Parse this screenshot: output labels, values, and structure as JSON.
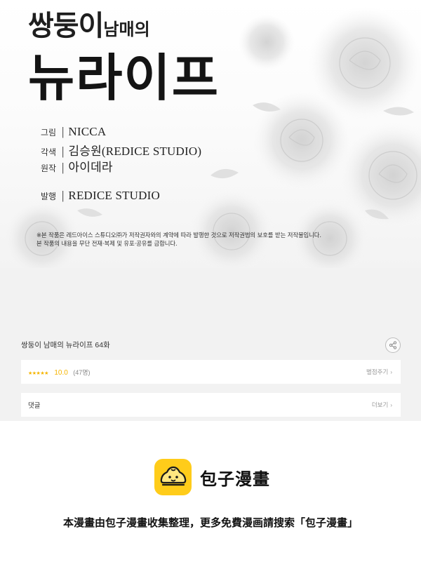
{
  "cover": {
    "title_top": "쌍둥이",
    "title_top_small": "남매의",
    "title_main": "뉴라이프",
    "credits": [
      {
        "key": "그림",
        "value": "NICCA"
      },
      {
        "key": "각색",
        "value": "김승원(REDICE STUDIO)"
      },
      {
        "key": "원작",
        "value": "아이데라"
      },
      {
        "key": "발행",
        "value": "REDICE STUDIO"
      }
    ],
    "separator": "|",
    "notice_line1": "※본 작품은 레드아이스 스튜디오㈜가 저작권자와의 계약에 따라 발행한 것으로 저작권법의 보호를 받는 저작물입니다.",
    "notice_line2": "본 작품의 내용을 무단 전재·복제 및 유포·공유를 금합니다."
  },
  "episode": {
    "title": "쌍둥이 남매의 뉴라이프 64화",
    "share_icon": "share-icon",
    "rating": {
      "stars": "★★★★★",
      "score": "10.0",
      "votes": "(47명)",
      "action": "별점주기",
      "value": 10.0,
      "max": 10
    },
    "comments": {
      "label": "댓글",
      "action": "더보기"
    },
    "chevron": "›"
  },
  "footer": {
    "brand_name": "包子漫畫",
    "logo_icon": "bun-logo-icon",
    "note": "本漫畫由包子漫畫收集整理，更多免費漫画請搜索「包子漫畫」"
  },
  "colors": {
    "panel_bg": "#f2f2f2",
    "star": "#f5b400",
    "logo_bg": "#ffcc1a"
  }
}
